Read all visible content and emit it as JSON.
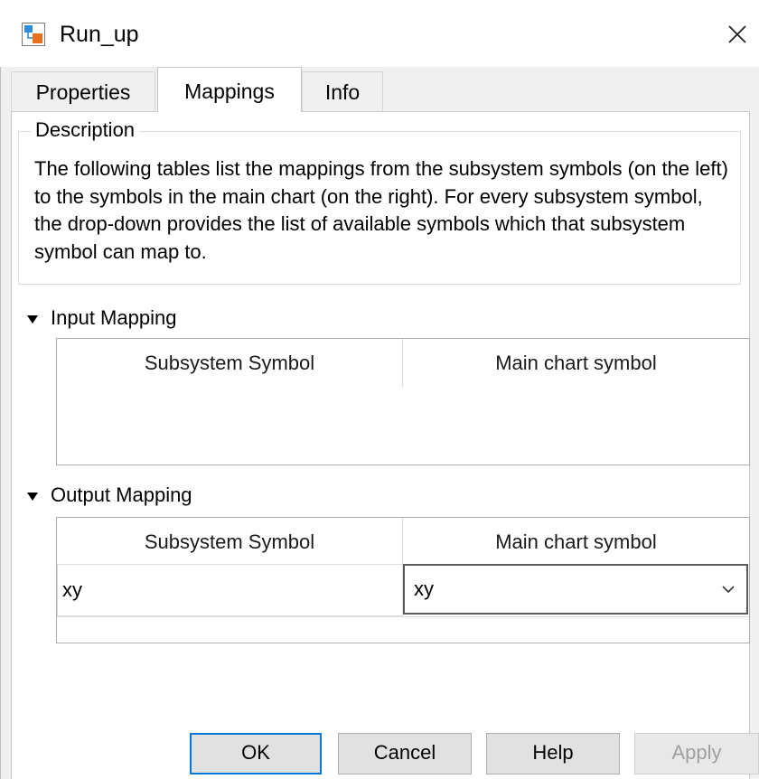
{
  "window": {
    "title": "Run_up",
    "icon": "stateflow-chart-icon",
    "close_icon": "close-icon"
  },
  "tabs": [
    {
      "label": "Properties",
      "active": false
    },
    {
      "label": "Mappings",
      "active": true
    },
    {
      "label": "Info",
      "active": false
    }
  ],
  "description": {
    "title": "Description",
    "text": "The following tables list the mappings from the subsystem symbols (on the left) to the symbols in the main chart (on the right). For every subsystem symbol, the drop-down provides the list of available symbols which that subsystem symbol can map to."
  },
  "input_mapping": {
    "title": "Input Mapping",
    "expanded": true,
    "columns": [
      "Subsystem Symbol",
      "Main chart symbol"
    ],
    "rows": []
  },
  "output_mapping": {
    "title": "Output Mapping",
    "expanded": true,
    "columns": [
      "Subsystem Symbol",
      "Main chart symbol"
    ],
    "rows": [
      {
        "subsystem_symbol": "xy",
        "main_chart_symbol": "xy"
      }
    ]
  },
  "buttons": {
    "ok": "OK",
    "cancel": "Cancel",
    "help": "Help",
    "apply": "Apply"
  },
  "colors": {
    "focus_accent": "#0078d7",
    "dialog_bg": "#f0f0f0",
    "icon_blue": "#2a8fd8",
    "icon_orange": "#e8701a"
  }
}
